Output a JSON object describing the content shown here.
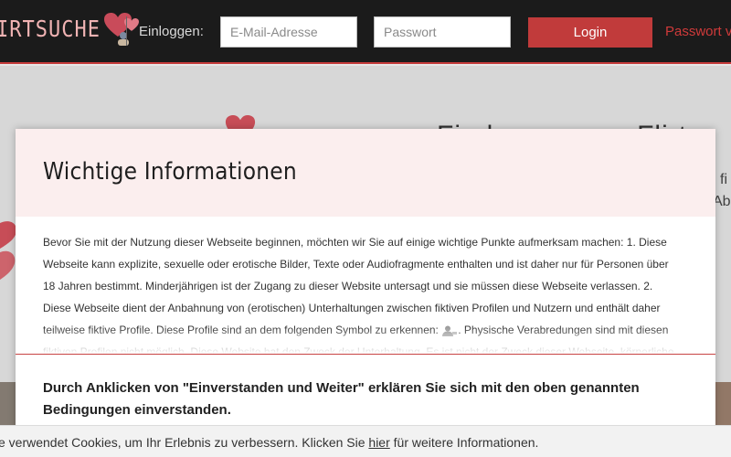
{
  "header": {
    "logo_text": "IRTSUCHE",
    "login_label": "Einloggen:",
    "email_placeholder": "E-Mail-Adresse",
    "password_placeholder": "Passwort",
    "login_button": "Login",
    "forgot_password": "Passwort v"
  },
  "hero": {
    "heading": "Finden ... ... ... Flirt",
    "sub1": "fi",
    "sub2": "Abe"
  },
  "modal": {
    "title": "Wichtige Informationen",
    "body_before_icon": "Bevor Sie mit der Nutzung dieser Webseite beginnen, möchten wir Sie auf einige wichtige Punkte aufmerksam machen: 1. Diese Webseite kann explizite, sexuelle oder erotische Bilder, Texte oder Audiofragmente enthalten und ist daher nur für Personen über 18 Jahren bestimmt. Minderjährigen ist der Zugang zu dieser Website untersagt und sie müssen diese Webseite verlassen. 2. Diese Webseite dient der Anbahnung von (erotischen) Unterhaltungen zwischen fiktiven Profilen und Nutzern und enthält daher teilweise fiktive Profile. Diese Profile sind an dem folgenden Symbol zu erkennen:",
    "body_after_icon": ". Physische Verabredungen sind mit diesen fiktiven Profilen nicht möglich. Diese Website hat den Zweck der Unterhaltung. Es ist nicht der Zweck dieser Webseite, körperliche",
    "agree_text": "Durch Anklicken von \"Einverstanden und Weiter\" erklären Sie sich mit den oben genannten Bedingungen einverstanden."
  },
  "cookie": {
    "text_before": "e verwendet Cookies, um Ihr Erlebnis zu verbessern. Klicken Sie ",
    "link": "hier",
    "text_after": " für weitere Informationen."
  },
  "colors": {
    "header_bg": "#1b1b1b",
    "accent": "#c13b3b",
    "modal_head_bg": "#fbeeee"
  }
}
